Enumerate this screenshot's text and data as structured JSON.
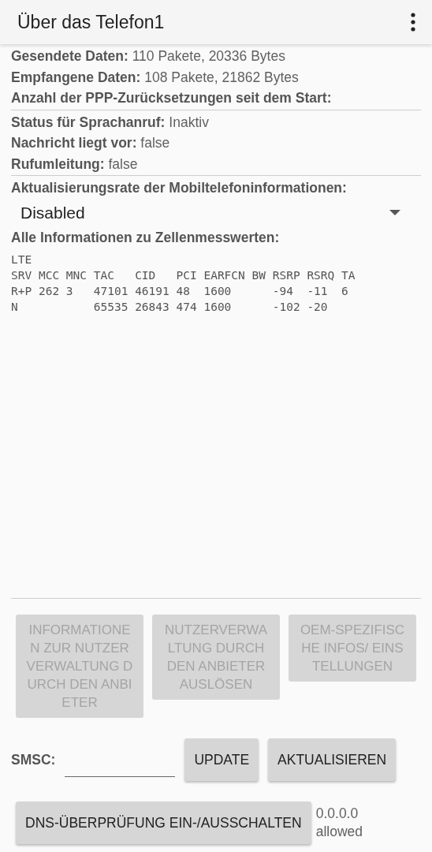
{
  "app_bar": {
    "title": "Über das Telefon1"
  },
  "info_groups": [
    [
      {
        "label": "Gesendete Daten:",
        "value": "110 Pakete, 20336 Bytes"
      },
      {
        "label": "Empfangene Daten:",
        "value": "108 Pakete, 21862 Bytes"
      },
      {
        "label": "Anzahl der PPP-Zurücksetzungen seit dem Start:"
      }
    ],
    [
      {
        "label": "Status für Sprachanruf:",
        "value": "Inaktiv"
      },
      {
        "label": "Nachricht liegt vor:",
        "value": "false"
      },
      {
        "label": "Rufumleitung:",
        "value": "false"
      }
    ]
  ],
  "refresh_rate": {
    "label": "Aktualisierungsrate der Mobiltelefoninformationen:",
    "value": "Disabled"
  },
  "cell_info": {
    "label": "Alle Informationen zu Zellenmesswerten:",
    "lines": [
      "LTE",
      "SRV MCC MNC TAC   CID   PCI EARFCN BW RSRP RSRQ TA",
      "R+P 262 3   47101 46191 48  1600      -94  -11  6",
      "N           65535 26843 474 1600      -102 -20"
    ]
  },
  "action_buttons": [
    {
      "label": "INFORMATIONEN ZUR NUTZERVERWALTUNG DURCH DEN ANBIETER",
      "disabled": true
    },
    {
      "label": "NUTZERVERWALTUNG DURCH DEN ANBIETER AUSLÖSEN",
      "disabled": true
    },
    {
      "label": "OEM-SPEZIFISCHE INFOS/ EINSTELLUNGEN",
      "disabled": true
    }
  ],
  "smsc": {
    "label": "SMSC:",
    "buttons": [
      {
        "label": "UPDATE",
        "disabled": false
      },
      {
        "label": "AKTUALISIEREN",
        "disabled": false
      }
    ]
  },
  "dns": {
    "button": {
      "label": "DNS-ÜBERPRÜFUNG EIN-/AUSSCHALTEN",
      "disabled": false
    },
    "status": [
      "0.0.0.0",
      "allowed"
    ]
  }
}
